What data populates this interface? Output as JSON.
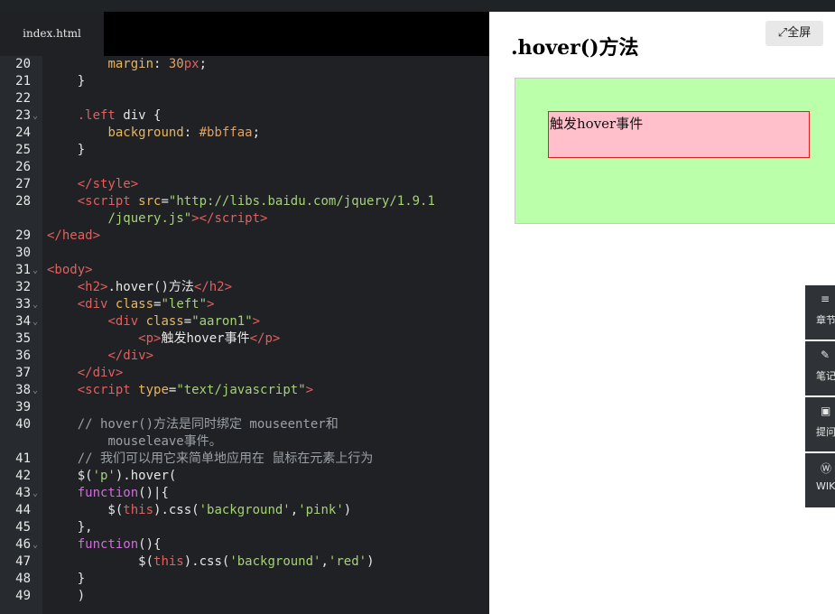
{
  "editor": {
    "tab_label": "index.html",
    "lines": [
      {
        "n": "20",
        "fold": false,
        "html": "        <span class='a'>margin</span>: <span class='n'>30</span><span class='t'>px</span>;"
      },
      {
        "n": "21",
        "fold": false,
        "html": "    }"
      },
      {
        "n": "22",
        "fold": false,
        "html": ""
      },
      {
        "n": "23",
        "fold": true,
        "html": "    <span class='cls'>.left</span> div {"
      },
      {
        "n": "24",
        "fold": false,
        "html": "        <span class='a'>background</span>: <span class='n'>#bbffaa</span>;"
      },
      {
        "n": "25",
        "fold": false,
        "html": "    }"
      },
      {
        "n": "26",
        "fold": false,
        "html": ""
      },
      {
        "n": "27",
        "fold": false,
        "html": "    <span class='t'>&lt;/style&gt;</span>"
      },
      {
        "n": "28",
        "fold": false,
        "wrap": true,
        "html": "    <span class='t'>&lt;script</span> <span class='a'>src</span>=<span class='s'>\"http://libs.baidu.com/jquery/1.9.1</span>\n        <span class='s'>/jquery.js\"</span><span class='t'>&gt;&lt;/script&gt;</span>"
      },
      {
        "n": "29",
        "fold": false,
        "html": "<span class='t'>&lt;/head&gt;</span>"
      },
      {
        "n": "30",
        "fold": false,
        "html": ""
      },
      {
        "n": "31",
        "fold": true,
        "html": "<span class='t'>&lt;body&gt;</span>"
      },
      {
        "n": "32",
        "fold": false,
        "html": "    <span class='t'>&lt;h2&gt;</span>.hover()方法<span class='t'>&lt;/h2&gt;</span>"
      },
      {
        "n": "33",
        "fold": true,
        "html": "    <span class='t'>&lt;div</span> <span class='a'>class</span>=<span class='s'>\"left\"</span><span class='t'>&gt;</span>"
      },
      {
        "n": "34",
        "fold": true,
        "html": "        <span class='t'>&lt;div</span> <span class='a'>class</span>=<span class='s'>\"aaron1\"</span><span class='t'>&gt;</span>"
      },
      {
        "n": "35",
        "fold": false,
        "html": "            <span class='t'>&lt;p&gt;</span>触发hover事件<span class='t'>&lt;/p&gt;</span>"
      },
      {
        "n": "36",
        "fold": false,
        "html": "        <span class='t'>&lt;/div&gt;</span>"
      },
      {
        "n": "37",
        "fold": false,
        "html": "    <span class='t'>&lt;/div&gt;</span>"
      },
      {
        "n": "38",
        "fold": true,
        "html": "    <span class='t'>&lt;script</span> <span class='a'>type</span>=<span class='s'>\"text/javascript\"</span><span class='t'>&gt;</span>"
      },
      {
        "n": "39",
        "fold": false,
        "html": ""
      },
      {
        "n": "40",
        "fold": false,
        "wrap": true,
        "html": "    <span class='cm'>// hover()方法是同时绑定 mouseenter和</span>\n        <span class='cm'>mouseleave事件。</span>"
      },
      {
        "n": "41",
        "fold": false,
        "html": "    <span class='cm'>// 我们可以用它来简单地应用在 鼠标在元素上行为</span>"
      },
      {
        "n": "42",
        "fold": false,
        "html": "    $(<span class='s'>'p'</span>).hover("
      },
      {
        "n": "43",
        "fold": true,
        "html": "    <span class='k'>function</span>()|{"
      },
      {
        "n": "44",
        "fold": false,
        "html": "        $(<span class='t'>this</span>).css(<span class='s'>'background'</span>,<span class='s'>'pink'</span>)"
      },
      {
        "n": "45",
        "fold": false,
        "html": "    },"
      },
      {
        "n": "46",
        "fold": true,
        "html": "    <span class='k'>function</span>(){"
      },
      {
        "n": "47",
        "fold": false,
        "html": "            $(<span class='t'>this</span>).css(<span class='s'>'background'</span>,<span class='s'>'red'</span>)"
      },
      {
        "n": "48",
        "fold": false,
        "html": "    }"
      },
      {
        "n": "49",
        "fold": false,
        "html": "    )"
      }
    ]
  },
  "preview": {
    "fullscreen_label": "全屏",
    "title": ".hover()方法",
    "paragraph": "触发hover事件",
    "colors": {
      "left_bg": "#bbffaa",
      "aaron1_bg": "pink",
      "aaron1_border": "#e02020"
    }
  },
  "sidebar": {
    "items": [
      {
        "label": "章节",
        "icon": "list-icon",
        "glyph": "≡"
      },
      {
        "label": "笔记",
        "icon": "pencil-icon",
        "glyph": "✎"
      },
      {
        "label": "提问",
        "icon": "question-icon",
        "glyph": "▣"
      },
      {
        "label": "WIKI",
        "icon": "wiki-icon",
        "glyph": "Ⓦ"
      }
    ]
  }
}
